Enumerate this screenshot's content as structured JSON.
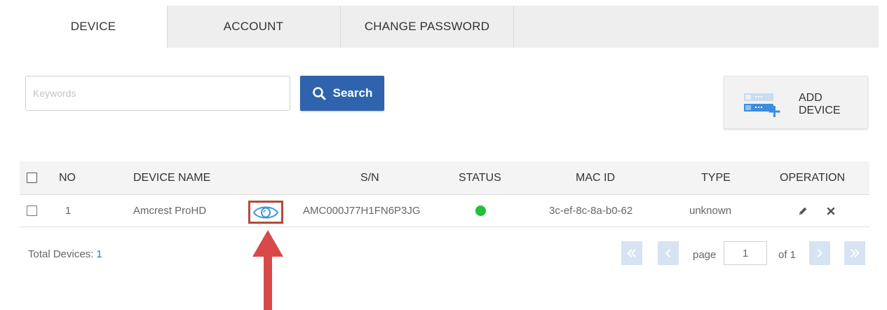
{
  "tabs": [
    {
      "label": "DEVICE",
      "active": true
    },
    {
      "label": "ACCOUNT",
      "active": false
    },
    {
      "label": "CHANGE PASSWORD",
      "active": false
    }
  ],
  "search": {
    "placeholder": "Keywords",
    "value": "",
    "button_label": "Search",
    "button_icon": "search-icon"
  },
  "add_device": {
    "label": "ADD\nDEVICE",
    "icon": "add-device-icon"
  },
  "table": {
    "columns": [
      "NO",
      "DEVICE NAME",
      "S/N",
      "STATUS",
      "MAC ID",
      "TYPE",
      "OPERATION"
    ],
    "rows": [
      {
        "no": "1",
        "device_name": "Amcrest ProHD",
        "view_icon": "eye-icon",
        "sn": "AMC000J77H1FN6P3JG",
        "status": "online",
        "status_color": "#22c03a",
        "mac_id": "3c-ef-8c-8a-b0-62",
        "type": "unknown",
        "operations": [
          "pencil-icon",
          "close-icon"
        ]
      }
    ]
  },
  "footer": {
    "total_label": "Total Devices:",
    "total_count": "1"
  },
  "pagination": {
    "page_label": "page",
    "current_page": "1",
    "of_label": "of 1",
    "first_icon": "double-chevron-left-icon",
    "prev_icon": "chevron-left-icon",
    "next_icon": "chevron-right-icon",
    "last_icon": "double-chevron-right-icon"
  },
  "colors": {
    "accent": "#2f63ae",
    "pager": "#d6e3f2",
    "highlight": "#b54a3c",
    "arrow": "#d84a4a"
  }
}
